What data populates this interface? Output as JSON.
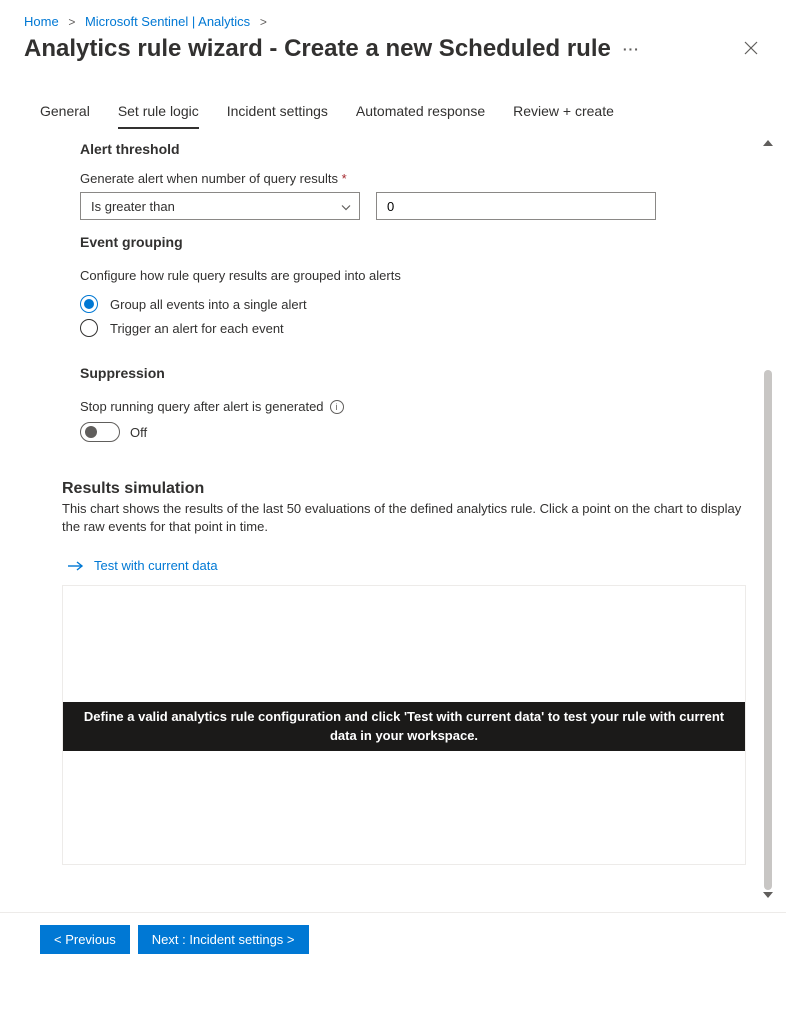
{
  "breadcrumb": {
    "home": "Home",
    "middle": "Microsoft Sentinel | Analytics"
  },
  "title": "Analytics rule wizard - Create a new Scheduled rule",
  "tabs": {
    "general": "General",
    "set_rule_logic": "Set rule logic",
    "incident_settings": "Incident settings",
    "automated_response": "Automated response",
    "review_create": "Review + create"
  },
  "alert_threshold": {
    "title": "Alert threshold",
    "label": "Generate alert when number of query results",
    "required_mark": "*",
    "operator": "Is greater than",
    "value": "0"
  },
  "event_grouping": {
    "title": "Event grouping",
    "description": "Configure how rule query results are grouped into alerts",
    "option_group_all": "Group all events into a single alert",
    "option_each": "Trigger an alert for each event"
  },
  "suppression": {
    "title": "Suppression",
    "label": "Stop running query after alert is generated",
    "state_text": "Off"
  },
  "results_simulation": {
    "title": "Results simulation",
    "description": "This chart shows the results of the last 50 evaluations of the defined analytics rule. Click a point on the chart to display the raw events for that point in time.",
    "test_link": "Test with current data",
    "overlay_message": "Define a valid analytics rule configuration and click 'Test with current data' to test your rule with current data in your workspace."
  },
  "footer": {
    "previous": "<  Previous",
    "next": "Next : Incident settings  >"
  }
}
